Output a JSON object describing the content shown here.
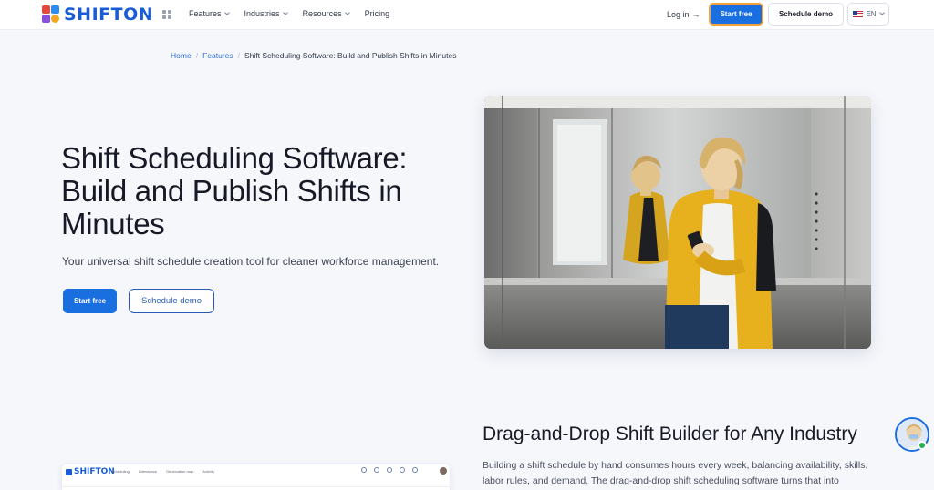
{
  "header": {
    "logo_text": "SHIFTON",
    "nav": [
      {
        "label": "Features",
        "has_dropdown": true
      },
      {
        "label": "Industries",
        "has_dropdown": true
      },
      {
        "label": "Resources",
        "has_dropdown": true
      },
      {
        "label": "Pricing",
        "has_dropdown": false
      }
    ],
    "login_label": "Log in",
    "login_icon": "arrow-right-icon",
    "start_free_label": "Start free",
    "schedule_demo_label": "Schedule demo",
    "language": "EN",
    "language_icon": "us-flag-icon"
  },
  "breadcrumb": {
    "home": "Home",
    "features": "Features",
    "current": "Shift Scheduling Software: Build and Publish Shifts in Minutes"
  },
  "hero": {
    "title": "Shift Scheduling Software: Build and Publish Shifts in Minutes",
    "subtitle": "Your universal shift schedule creation tool for cleaner workforce management.",
    "start_free_label": "Start free",
    "schedule_demo_label": "Schedule demo"
  },
  "section2": {
    "title": "Drag-and-Drop Shift Builder for Any Industry",
    "text": "Building a shift schedule by hand consumes hours every week, balancing availability, skills, labor rules, and demand. The drag-and-drop shift scheduling software turns that into"
  },
  "app_preview": {
    "logo_text": "SHIFTON",
    "nav": [
      "Scheduling",
      "Attendance",
      "Geolocation map",
      "Activity"
    ]
  },
  "colors": {
    "primary": "#1a6fe0",
    "logo_blue": "#1b5bd6",
    "focus_ring": "#f0a33a",
    "background": "#f6f7fb"
  }
}
